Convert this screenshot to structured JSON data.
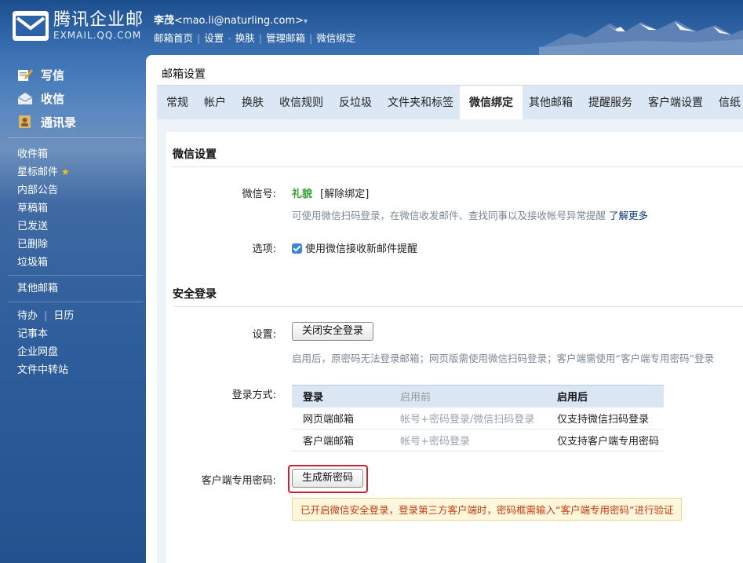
{
  "brand": {
    "cn": "腾讯企业邮",
    "en": "EXMAIL.QQ.COM"
  },
  "user": {
    "name": "李茂",
    "email": "<mao.li@naturling.com>",
    "caret": "▾"
  },
  "top_links": [
    "邮箱首页",
    "设置",
    "换肤",
    "管理邮箱",
    "微信绑定"
  ],
  "sidebar": {
    "main": [
      {
        "label": "写信",
        "icon": "compose-icon"
      },
      {
        "label": "收信",
        "icon": "inbox-icon"
      },
      {
        "label": "通讯录",
        "icon": "contacts-icon"
      }
    ],
    "folders": [
      "收件箱",
      "星标邮件",
      "内部公告",
      "草稿箱",
      "已发送",
      "已删除",
      "垃圾箱"
    ],
    "other_mail": "其他邮箱",
    "tools": {
      "todo": "待办",
      "calendar": "日历",
      "notes": "记事本",
      "disk": "企业网盘",
      "transfer": "文件中转站"
    }
  },
  "panel": {
    "title": "邮箱设置",
    "tabs": [
      "常规",
      "帐户",
      "换肤",
      "收信规则",
      "反垃圾",
      "文件夹和标签",
      "微信绑定",
      "其他邮箱",
      "提醒服务",
      "客户端设置",
      "信纸"
    ],
    "active_tab": "微信绑定"
  },
  "wechat": {
    "section_title": "微信设置",
    "wechat_label": "微信号:",
    "wechat_name": "礼貌",
    "unbind": "[解除绑定]",
    "hint": "可使用微信扫码登录，在微信收发邮件、查找同事以及接收帐号异常提醒",
    "learn_more": "了解更多",
    "option_label": "选项:",
    "option_text": "使用微信接收新邮件提醒"
  },
  "security": {
    "section_title": "安全登录",
    "setting_label": "设置:",
    "close_btn": "关闭安全登录",
    "desc": "启用后，原密码无法登录邮箱；网页版需使用微信扫码登录；客户端需使用“客户端专用密码”登录",
    "method_label": "登录方式:",
    "table": {
      "headers": [
        "登录",
        "启用前",
        "启用后"
      ],
      "rows": [
        [
          "网页端邮箱",
          "帐号+密码登录/微信扫码登录",
          "仅支持微信扫码登录"
        ],
        [
          "客户端邮箱",
          "帐号+密码登录",
          "仅支持客户端专用密码"
        ]
      ]
    },
    "client_pwd_label": "客户端专用密码:",
    "gen_btn": "生成新密码",
    "warning": "已开启微信安全登录，登录第三方客户端时，密码框需输入“客户端专用密码”进行验证"
  },
  "colors": {
    "accent_blue": "#2f5e9c",
    "tab_bg": "#dbe7f4",
    "green": "#37a135",
    "warning": "#c53a13"
  }
}
